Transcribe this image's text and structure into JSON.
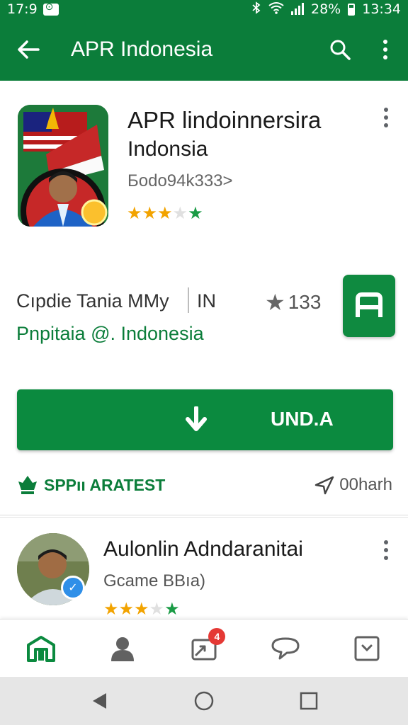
{
  "status_bar": {
    "time_left": "17:9",
    "battery": "28%",
    "time_right": "13:34",
    "icons": [
      "notification-icon",
      "bluetooth-icon",
      "wifi-icon",
      "signal-icon",
      "battery-icon"
    ]
  },
  "app_bar": {
    "title": "APR Indonesia",
    "icons": [
      "back-arrow-icon",
      "search-icon",
      "more-vert-icon"
    ]
  },
  "app": {
    "name": "APR lindoinnersira",
    "subtitle": "Indonsia",
    "developer": "Бodo94k333>",
    "stars": {
      "gold": "★★★",
      "grey": "★",
      "green": "★"
    },
    "meta_left": "Cıpdie Tania MMy",
    "meta_region": "IN",
    "meta_rating": "133",
    "publisher": "Pnpitaia @. Indonesia",
    "install_label": "UND.A",
    "tag_label": "SPPıı ARATEST",
    "time_label": "00harh"
  },
  "second_item": {
    "title": "Aulonlin Adndaranitai",
    "subtitle": "Gcame BBıa)",
    "stars": {
      "gold": "★★★",
      "grey": "★",
      "green": "★"
    }
  },
  "bottom_nav": {
    "items": [
      "home-icon",
      "profile-icon",
      "inbox-icon",
      "chat-icon",
      "downloads-icon"
    ],
    "badge": "4"
  },
  "system_nav": [
    "back-triangle-icon",
    "home-circle-icon",
    "recents-square-icon"
  ],
  "colors": {
    "brand_green": "#0b7d3a",
    "button_green": "#0b8a3f",
    "star_gold": "#f2a300",
    "badge_red": "#e53935"
  }
}
